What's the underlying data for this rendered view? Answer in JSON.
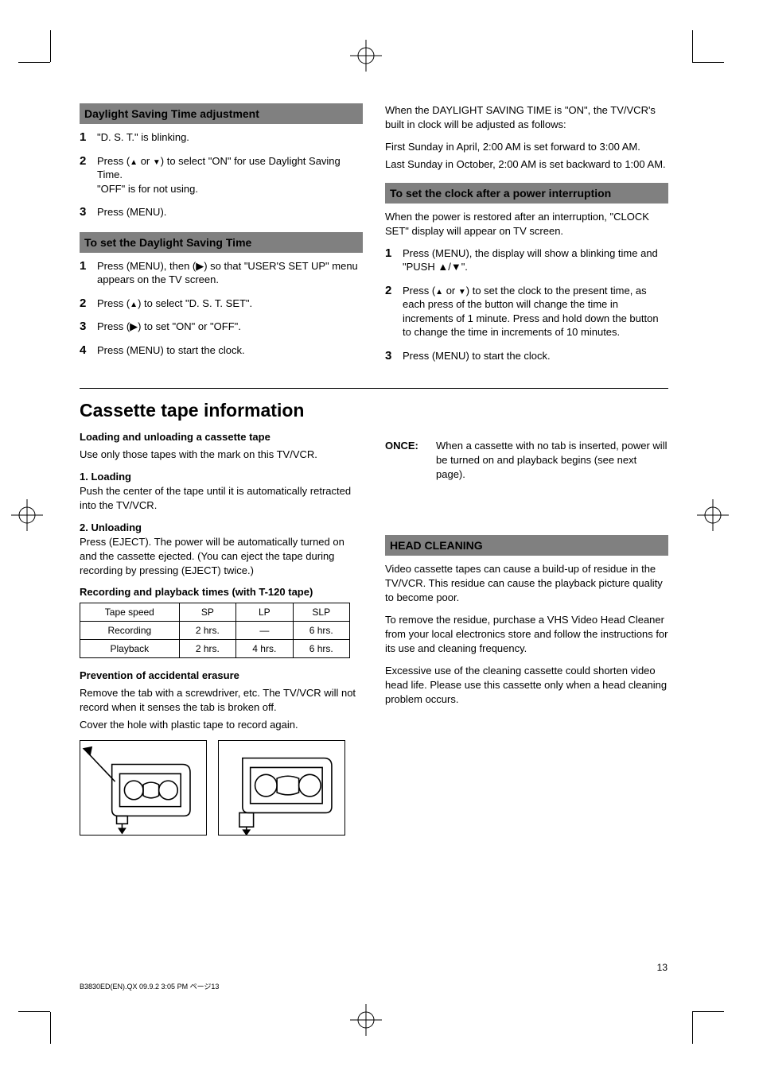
{
  "left_col": {
    "heading1": "Daylight Saving Time adjustment",
    "step1_num": "1",
    "step1": "\"D. S. T.\" is blinking.",
    "step2_num": "2",
    "step2_p1": "Press (",
    "step2_p2": " or ",
    "step2_p3": ") to select \"ON\" for use Daylight Saving Time.",
    "step2_note": "\"OFF\" is for not using.",
    "step3_num": "3",
    "step3": "Press (MENU).",
    "heading2": "To set the Daylight Saving Time",
    "step4a_num": "1",
    "step4a": "Press (MENU), then (▶) so that \"USER'S SET UP\" menu appears on the TV screen.",
    "step4b_num": "2",
    "step4b_p1": "Press (",
    "step4b_p2": ") to select \"D. S. T. SET\".",
    "step4c_num": "3",
    "step4c": "Press (▶) to set \"ON\" or \"OFF\".",
    "step4d_num": "4",
    "step4d": "Press (MENU) to start the clock."
  },
  "right_col": {
    "note1": "When the DAYLIGHT SAVING TIME is \"ON\", the TV/VCR's built in clock will be adjusted as follows:",
    "note2": "First Sunday in April, 2:00 AM is set forward to 3:00 AM.",
    "note3": "Last Sunday in October, 2:00 AM is set backward to 1:00 AM.",
    "heading": "To set the clock after a power interruption",
    "p1": "When the power is restored after an interruption, \"CLOCK SET\" display will appear on TV screen.",
    "step1_num": "1",
    "step1": "Press (MENU), the display will show a blinking time and \"PUSH ▲/▼\".",
    "step2_num": "2",
    "step2_p1": "Press (",
    "step2_p2": " or ",
    "step2_p3": ") to set the clock to the present time, as each press of the button will change the time in increments of 1 minute. Press and hold down the button to change the time in increments of 10 minutes.",
    "step3_num": "3",
    "step3": "Press (MENU) to start the clock."
  },
  "bottom": {
    "title": "Cassette tape information",
    "loading_title": "Loading and unloading a cassette tape",
    "load_p": "Use only those tapes with the mark      on this TV/VCR.",
    "load_1_title": "1. Loading",
    "load_1_body": "Push the center of the tape until it is automatically retracted into the TV/VCR.",
    "load_2_title": "2. Unloading",
    "load_2_body": "Press (EJECT). The power will be automatically turned on and the cassette ejected. (You can eject the tape during recording by pressing (EJECT) twice.)",
    "table_label": "Recording and playback times (with T-120 tape)",
    "table": {
      "header": [
        "Tape speed",
        "SP",
        "LP",
        "SLP"
      ],
      "rows": [
        [
          "Recording",
          "2 hrs.",
          "—",
          "6 hrs."
        ],
        [
          "Playback",
          "2 hrs.",
          "4 hrs.",
          "6 hrs."
        ]
      ]
    },
    "prevent_title": "Prevention of accidental erasure",
    "prevent_body": "Remove the tab with a screwdriver, etc. The TV/VCR will not record when it senses the tab is broken off.",
    "prevent_body2": "Cover the hole with plastic tape to record again.",
    "once_label": "ONCE:",
    "once_body": "When a cassette with no tab is inserted, power will be turned on and playback begins (see next page).",
    "heading_bar": "HEAD CLEANING",
    "hc_p1": "Video cassette tapes can cause a build-up of residue in the TV/VCR. This residue can cause the playback picture quality to become poor.",
    "hc_p2": "To remove the residue, purchase a VHS Video Head Cleaner from your local electronics store and follow the instructions for its use and cleaning frequency.",
    "hc_p3": "Excessive use of the cleaning cassette could shorten video head life. Please use this cassette only when a head cleaning problem occurs."
  },
  "page_num": "13",
  "filename": "B3830ED(EN).QX  09.9.2 3:05 PM  ページ13"
}
